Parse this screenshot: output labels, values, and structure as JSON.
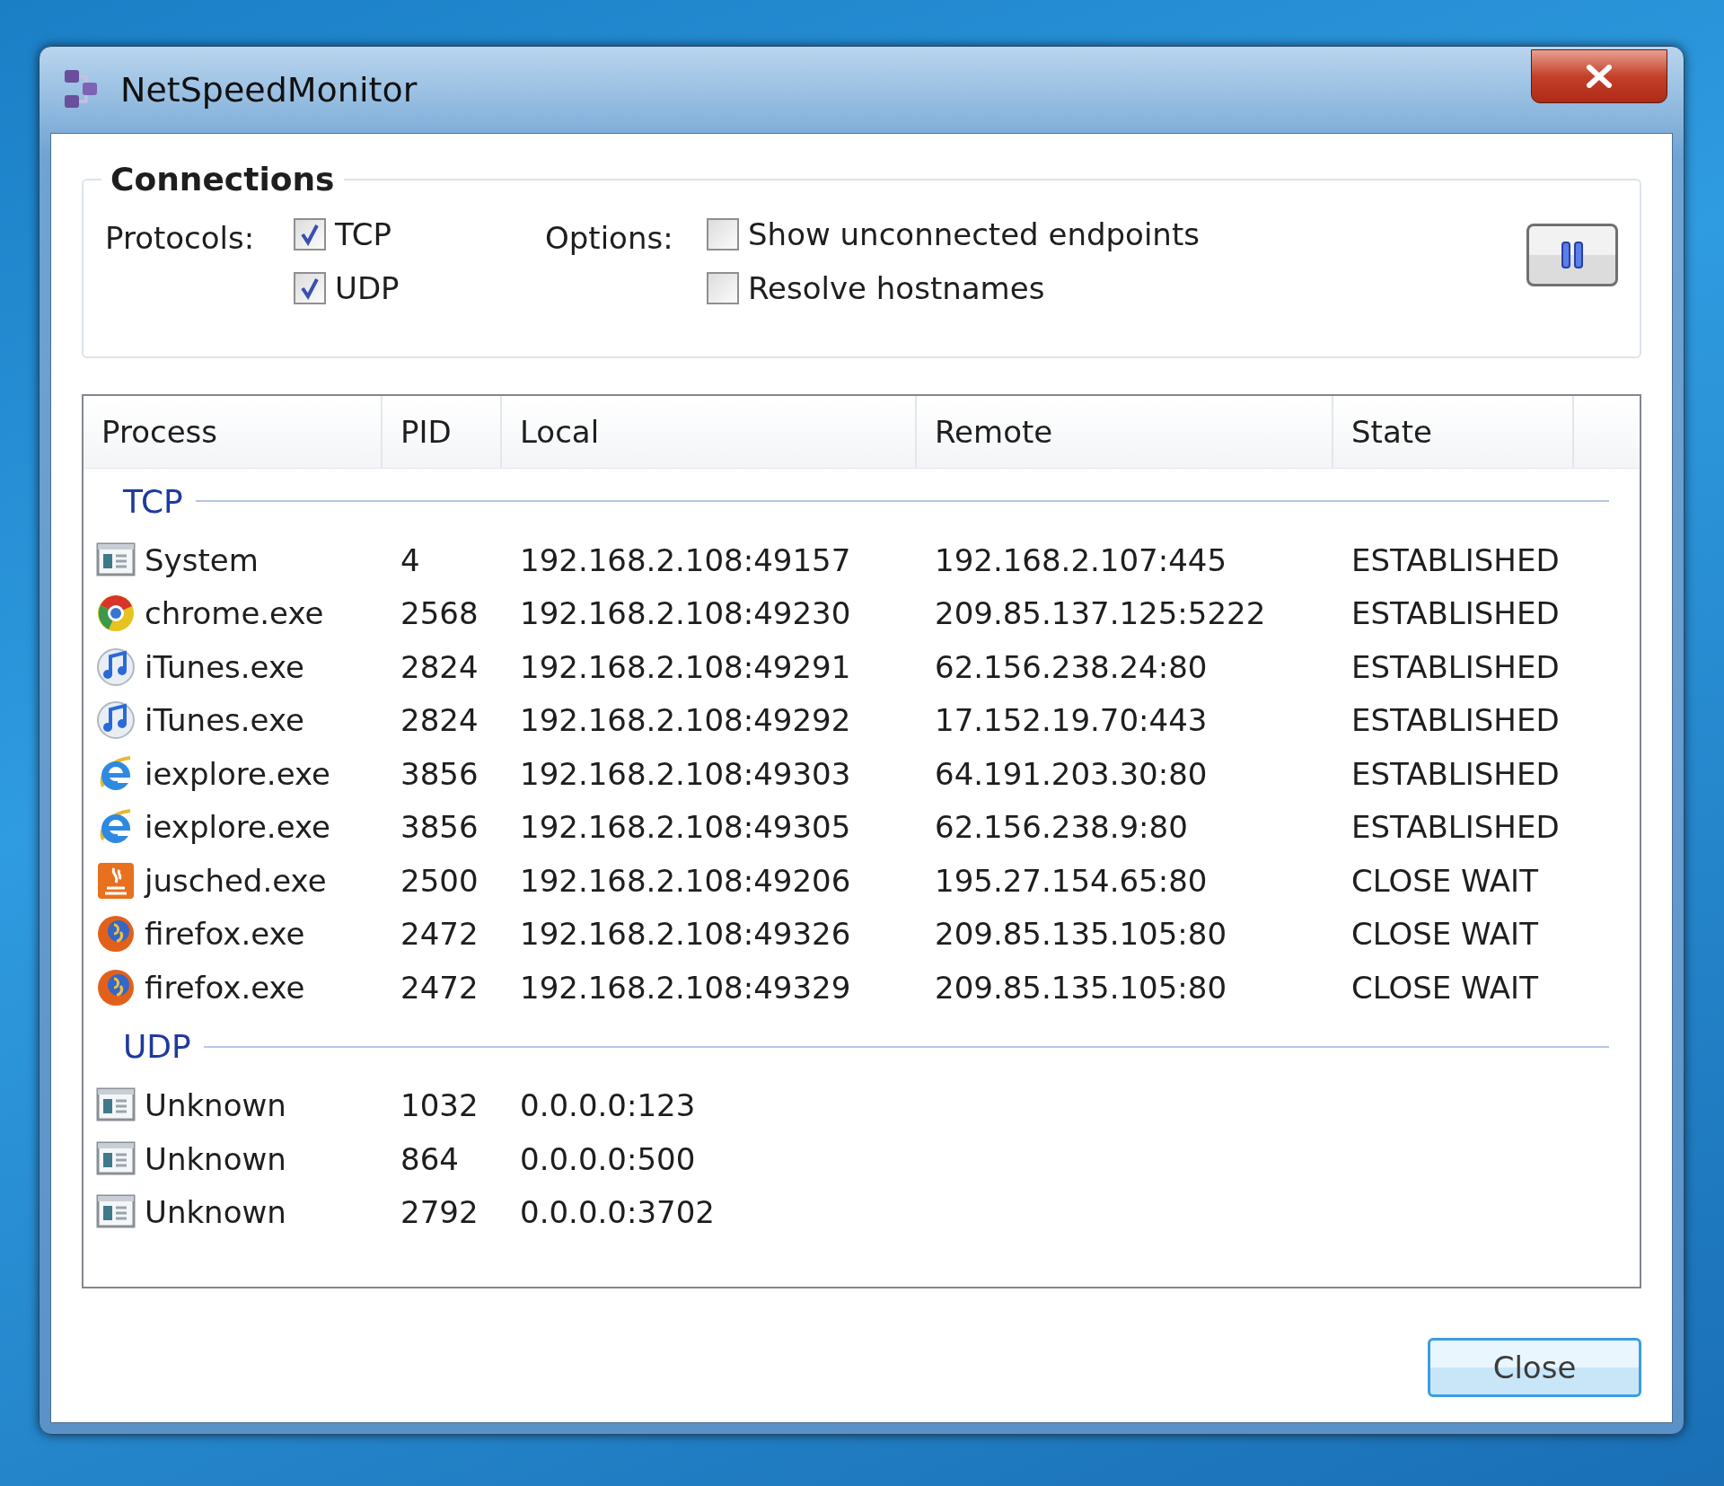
{
  "window": {
    "title": "NetSpeedMonitor"
  },
  "connections": {
    "title": "Connections",
    "protocols_label": "Protocols:",
    "protocols": [
      {
        "label": "TCP",
        "checked": true
      },
      {
        "label": "UDP",
        "checked": true
      }
    ],
    "options_label": "Options:",
    "options": [
      {
        "label": "Show unconnected endpoints",
        "checked": false
      },
      {
        "label": "Resolve hostnames",
        "checked": false
      }
    ]
  },
  "table": {
    "columns": [
      "Process",
      "PID",
      "Local",
      "Remote",
      "State"
    ],
    "groups": [
      {
        "title": "TCP",
        "rows": [
          {
            "kind": "window",
            "process": "System",
            "pid": "4",
            "local": "192.168.2.108:49157",
            "remote": "192.168.2.107:445",
            "state": "ESTABLISHED"
          },
          {
            "kind": "ring",
            "process": "chrome.exe",
            "pid": "2568",
            "local": "192.168.2.108:49230",
            "remote": "209.85.137.125:5222",
            "state": "ESTABLISHED"
          },
          {
            "kind": "note",
            "process": "iTunes.exe",
            "pid": "2824",
            "local": "192.168.2.108:49291",
            "remote": "62.156.238.24:80",
            "state": "ESTABLISHED"
          },
          {
            "kind": "note",
            "process": "iTunes.exe",
            "pid": "2824",
            "local": "192.168.2.108:49292",
            "remote": "17.152.19.70:443",
            "state": "ESTABLISHED"
          },
          {
            "kind": "e",
            "process": "iexplore.exe",
            "pid": "3856",
            "local": "192.168.2.108:49303",
            "remote": "64.191.203.30:80",
            "state": "ESTABLISHED"
          },
          {
            "kind": "e",
            "process": "iexplore.exe",
            "pid": "3856",
            "local": "192.168.2.108:49305",
            "remote": "62.156.238.9:80",
            "state": "ESTABLISHED"
          },
          {
            "kind": "cup",
            "process": "jusched.exe",
            "pid": "2500",
            "local": "192.168.2.108:49206",
            "remote": "195.27.154.65:80",
            "state": "CLOSE WAIT"
          },
          {
            "kind": "globe",
            "process": "firefox.exe",
            "pid": "2472",
            "local": "192.168.2.108:49326",
            "remote": "209.85.135.105:80",
            "state": "CLOSE WAIT"
          },
          {
            "kind": "globe",
            "process": "firefox.exe",
            "pid": "2472",
            "local": "192.168.2.108:49329",
            "remote": "209.85.135.105:80",
            "state": "CLOSE WAIT"
          }
        ]
      },
      {
        "title": "UDP",
        "rows": [
          {
            "kind": "window",
            "process": "Unknown",
            "pid": "1032",
            "local": "0.0.0.0:123"
          },
          {
            "kind": "window",
            "process": "Unknown",
            "pid": "864",
            "local": "0.0.0.0:500"
          },
          {
            "kind": "window",
            "process": "Unknown",
            "pid": "2792",
            "local": "0.0.0.0:3702"
          }
        ]
      }
    ]
  },
  "buttons": [
    {
      "label": "Close"
    }
  ]
}
